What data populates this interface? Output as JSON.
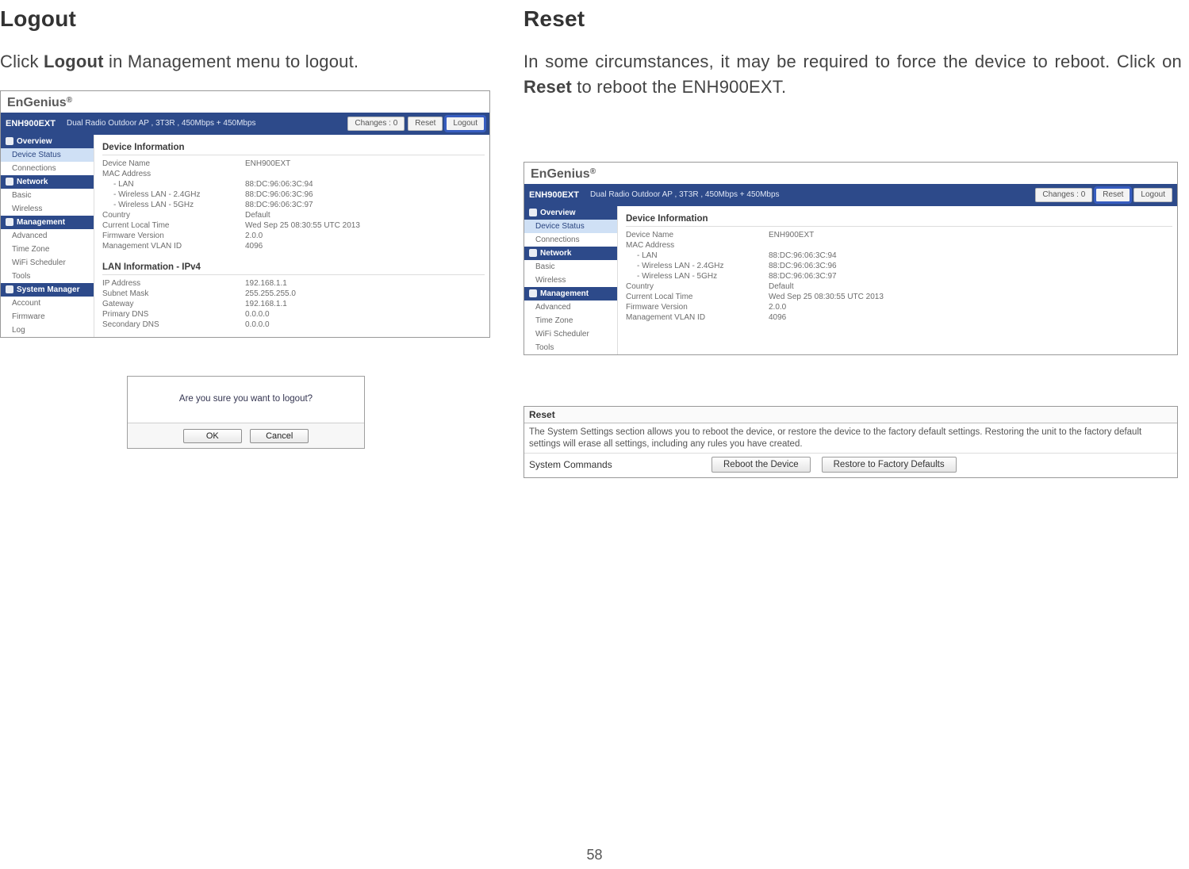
{
  "page_number": "58",
  "left": {
    "title": "Logout",
    "instruction_pre": "Click ",
    "instruction_bold": "Logout",
    "instruction_post": " in Management menu to logout."
  },
  "right": {
    "title": "Reset",
    "instruction_line1_pre": "In some circumstances, it may be required to force the device to reboot. Click on ",
    "instruction_bold": "Reset",
    "instruction_line1_post": " to reboot the ENH900EXT."
  },
  "brand": "EnGenius",
  "brand_mark": "®",
  "header": {
    "model": "ENH900EXT",
    "desc": "Dual Radio Outdoor AP , 3T3R , 450Mbps + 450Mbps",
    "changes": "Changes : 0",
    "reset": "Reset",
    "logout": "Logout"
  },
  "sidebar": {
    "groups": [
      {
        "label": "Overview",
        "items": [
          {
            "label": "Device Status",
            "active": true
          },
          {
            "label": "Connections"
          }
        ]
      },
      {
        "label": "Network",
        "items": [
          {
            "label": "Basic"
          },
          {
            "label": "Wireless"
          }
        ]
      },
      {
        "label": "Management",
        "items": [
          {
            "label": "Advanced"
          },
          {
            "label": "Time Zone"
          },
          {
            "label": "WiFi Scheduler"
          },
          {
            "label": "Tools"
          }
        ]
      },
      {
        "label": "System Manager",
        "items": [
          {
            "label": "Account"
          },
          {
            "label": "Firmware"
          },
          {
            "label": "Log"
          }
        ]
      }
    ]
  },
  "device_info": {
    "heading": "Device Information",
    "rows": [
      {
        "k": "Device Name",
        "v": "ENH900EXT"
      },
      {
        "k": "MAC Address",
        "v": ""
      },
      {
        "k": "- LAN",
        "v": "88:DC:96:06:3C:94",
        "indent": true
      },
      {
        "k": "- Wireless LAN - 2.4GHz",
        "v": "88:DC:96:06:3C:96",
        "indent": true
      },
      {
        "k": "- Wireless LAN - 5GHz",
        "v": "88:DC:96:06:3C:97",
        "indent": true
      },
      {
        "k": "Country",
        "v": "Default"
      },
      {
        "k": "Current Local Time",
        "v": "Wed Sep 25 08:30:55 UTC 2013"
      },
      {
        "k": "Firmware Version",
        "v": "2.0.0"
      },
      {
        "k": "Management VLAN ID",
        "v": "4096"
      }
    ]
  },
  "lan_info": {
    "heading": "LAN Information - IPv4",
    "rows": [
      {
        "k": "IP Address",
        "v": "192.168.1.1"
      },
      {
        "k": "Subnet Mask",
        "v": "255.255.255.0"
      },
      {
        "k": "Gateway",
        "v": "192.168.1.1"
      },
      {
        "k": "Primary DNS",
        "v": "0.0.0.0"
      },
      {
        "k": "Secondary DNS",
        "v": "0.0.0.0"
      }
    ]
  },
  "dialog": {
    "message": "Are you sure you want to logout?",
    "ok": "OK",
    "cancel": "Cancel"
  },
  "reset_box": {
    "title": "Reset",
    "desc": "The System Settings section allows you to reboot the device, or restore the device to the factory default settings. Restoring the unit to the factory default settings will erase all settings, including any rules you have created.",
    "cmd_label": "System Commands",
    "btn_reboot": "Reboot the Device",
    "btn_restore": "Restore to Factory Defaults"
  }
}
